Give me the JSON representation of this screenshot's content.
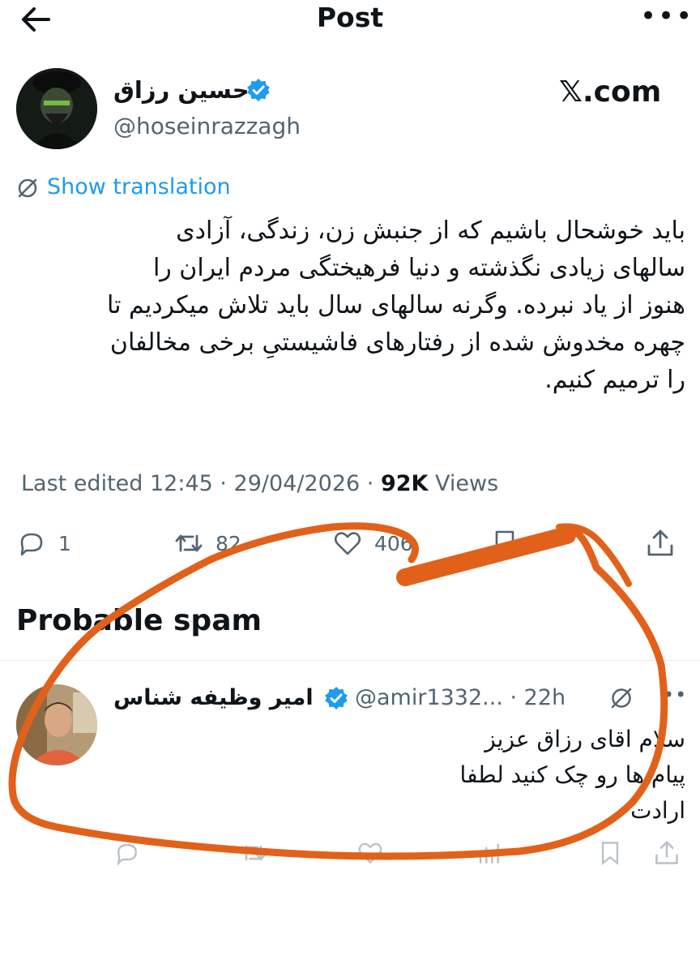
{
  "header": {
    "title": "Post",
    "back_icon": "arrow-left-icon",
    "more_icon": "more-horizontal-icon"
  },
  "author": {
    "name": "حسین رزاق",
    "handle": "@hoseinrazzagh",
    "verified": true
  },
  "watermark": "𝕏.com",
  "translation": {
    "label": "Show translation"
  },
  "post": {
    "text": "باید خوشحال باشیم که از جنبش زن، زندگی، آزادی\nسالهای زیادی نگذشته و دنیا فرهیختگی مردم ایران را\nهنوز از یاد نبرده. وگرنه سالهای سال باید تلاش میکردیم تا\nچهره مخدوش شده از رفتارهای فاشیستیِ برخی مخالفان\nرا ترمیم کنیم."
  },
  "meta": {
    "edited": "Last edited 12:45 · 29/04/2026",
    "sep": "·",
    "views_count": "92K",
    "views_label": "Views"
  },
  "actions": {
    "replies": "1",
    "reposts": "82",
    "likes": "406",
    "bookmarks": "5"
  },
  "section": {
    "title": "Probable spam"
  },
  "reply": {
    "name": "امیر وظیفه شناس",
    "handle": "@amir1332...",
    "time": "· 22h",
    "text": "سلام اقای رزاق عزیز\nپیام ها رو چک کنید لطفا\nارادت"
  },
  "colors": {
    "accent": "#1d9bf0",
    "annotation": "#e2611a",
    "muted": "#536471"
  }
}
